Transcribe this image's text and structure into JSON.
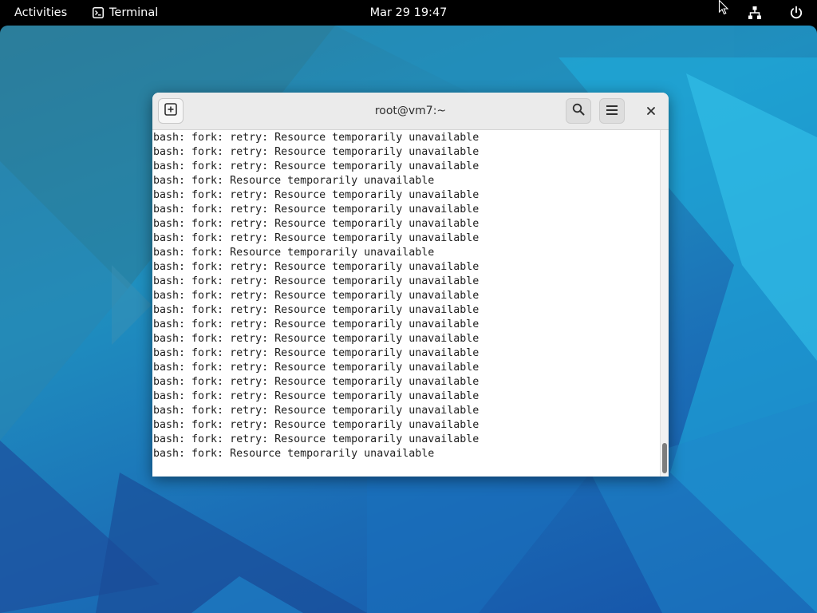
{
  "topbar": {
    "activities_label": "Activities",
    "app_name": "Terminal",
    "clock": "Mar 29  19:47"
  },
  "window": {
    "title": "root@vm7:~"
  },
  "terminal": {
    "lines": [
      "bash: fork: retry: Resource temporarily unavailable",
      "bash: fork: retry: Resource temporarily unavailable",
      "bash: fork: retry: Resource temporarily unavailable",
      "bash: fork: Resource temporarily unavailable",
      "bash: fork: retry: Resource temporarily unavailable",
      "bash: fork: retry: Resource temporarily unavailable",
      "bash: fork: retry: Resource temporarily unavailable",
      "bash: fork: retry: Resource temporarily unavailable",
      "bash: fork: Resource temporarily unavailable",
      "bash: fork: retry: Resource temporarily unavailable",
      "bash: fork: retry: Resource temporarily unavailable",
      "bash: fork: retry: Resource temporarily unavailable",
      "bash: fork: retry: Resource temporarily unavailable",
      "bash: fork: retry: Resource temporarily unavailable",
      "bash: fork: retry: Resource temporarily unavailable",
      "bash: fork: retry: Resource temporarily unavailable",
      "bash: fork: retry: Resource temporarily unavailable",
      "bash: fork: retry: Resource temporarily unavailable",
      "bash: fork: retry: Resource temporarily unavailable",
      "bash: fork: retry: Resource temporarily unavailable",
      "bash: fork: retry: Resource temporarily unavailable",
      "bash: fork: retry: Resource temporarily unavailable",
      "bash: fork: Resource temporarily unavailable"
    ],
    "scroll_position": "bottom"
  },
  "icons": {
    "app_menu": "terminal-icon",
    "cursor": "mouse-pointer-icon",
    "network": "network-wired-icon",
    "power": "power-icon",
    "new_tab": "new-tab-icon",
    "search": "search-icon",
    "menu": "hamburger-menu-icon",
    "close": "close-icon"
  },
  "colors": {
    "topbar_bg": "#000000",
    "headerbar_bg": "#ebebeb",
    "terminal_bg": "#ffffff",
    "terminal_fg": "#1e1e1e",
    "wallpaper_primary": "#1b6fb7",
    "wallpaper_accent": "#2ec3e6"
  }
}
